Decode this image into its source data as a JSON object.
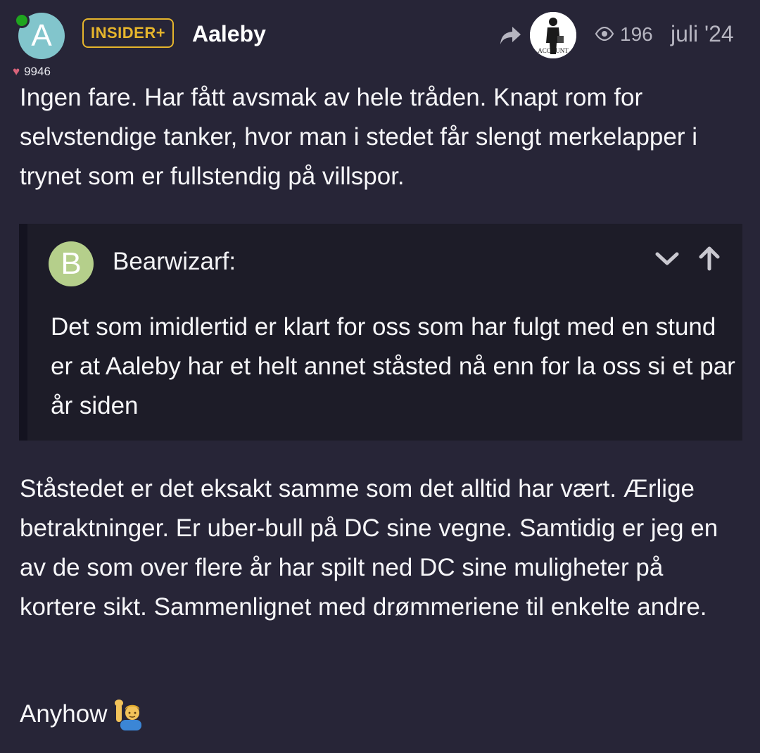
{
  "post": {
    "author": {
      "avatar_letter": "A",
      "avatar_color": "#82c5cc",
      "online": true,
      "badge": "INSIDER+",
      "badge_color": "#e6b52c",
      "username": "Aaleby",
      "likes": "9946"
    },
    "meta": {
      "reply_to_avatar": "ACCOUNT",
      "views": "196",
      "date": "juli '24"
    },
    "paragraph_1": "Ingen fare. Har fått avsmak av hele tråden. Knapt rom for selvstendige tanker, hvor man i stedet får slengt merkelapper i trynet som er fullstendig på villspor.",
    "quote": {
      "avatar_letter": "B",
      "avatar_color": "#b5cf8b",
      "author": "Bearwizarf:",
      "text": "Det som imidlertid er klart for oss som har fulgt med en stund er at Aaleby har et helt annet ståsted nå enn for la oss si et par år siden"
    },
    "paragraph_2": "Ståstedet er det eksakt samme som det alltid har vært. Ærlige betraktninger. Er uber-bull på DC sine vegne. Samtidig er jeg en av de som over flere år har spilt ned DC sine muligheter på kortere sikt. Sammenlignet med drømmeriene til enkelte andre.",
    "paragraph_3": "Anyhow",
    "paragraph_3_emoji": "person-raising-hand-emoji"
  },
  "colors": {
    "background": "#272537",
    "quote_background": "#1d1c28",
    "heart": "#d9637a",
    "online": "#1fa51f"
  }
}
